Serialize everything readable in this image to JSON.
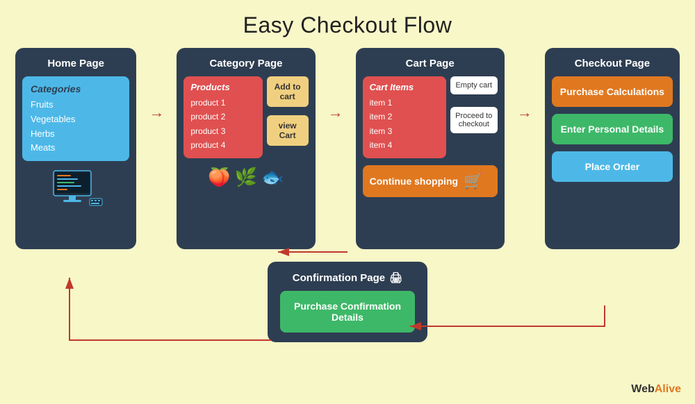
{
  "title": "Easy Checkout Flow",
  "pages": {
    "home": {
      "title": "Home Page",
      "inner_title": "Categories",
      "items": [
        "Fruits",
        "Vegetables",
        "Herbs",
        "Meats"
      ]
    },
    "category": {
      "title": "Category Page",
      "inner_title": "Products",
      "items": [
        "product 1",
        "product 2",
        "product 3",
        "product 4"
      ],
      "btn_add": "Add\nto cart",
      "btn_view": "view Cart",
      "emojis": [
        "🍑",
        "🌿",
        "🐟"
      ]
    },
    "cart": {
      "title": "Cart Page",
      "inner_title": "Cart Items",
      "items": [
        "item 1",
        "item 2",
        "item 3",
        "item 4"
      ],
      "btn_empty": "Empty cart",
      "btn_proceed": "Proceed to checkout",
      "btn_continue": "Continue shopping"
    },
    "checkout": {
      "title": "Checkout Page",
      "btn_calc": "Purchase Calculations",
      "btn_personal": "Enter Personal Details",
      "btn_order": "Place Order"
    },
    "confirmation": {
      "title": "Confirmation Page",
      "icon": "🖨",
      "btn_details": "Purchase Confirmation Details"
    }
  },
  "branding": {
    "web": "Web",
    "alive": "Alive"
  }
}
